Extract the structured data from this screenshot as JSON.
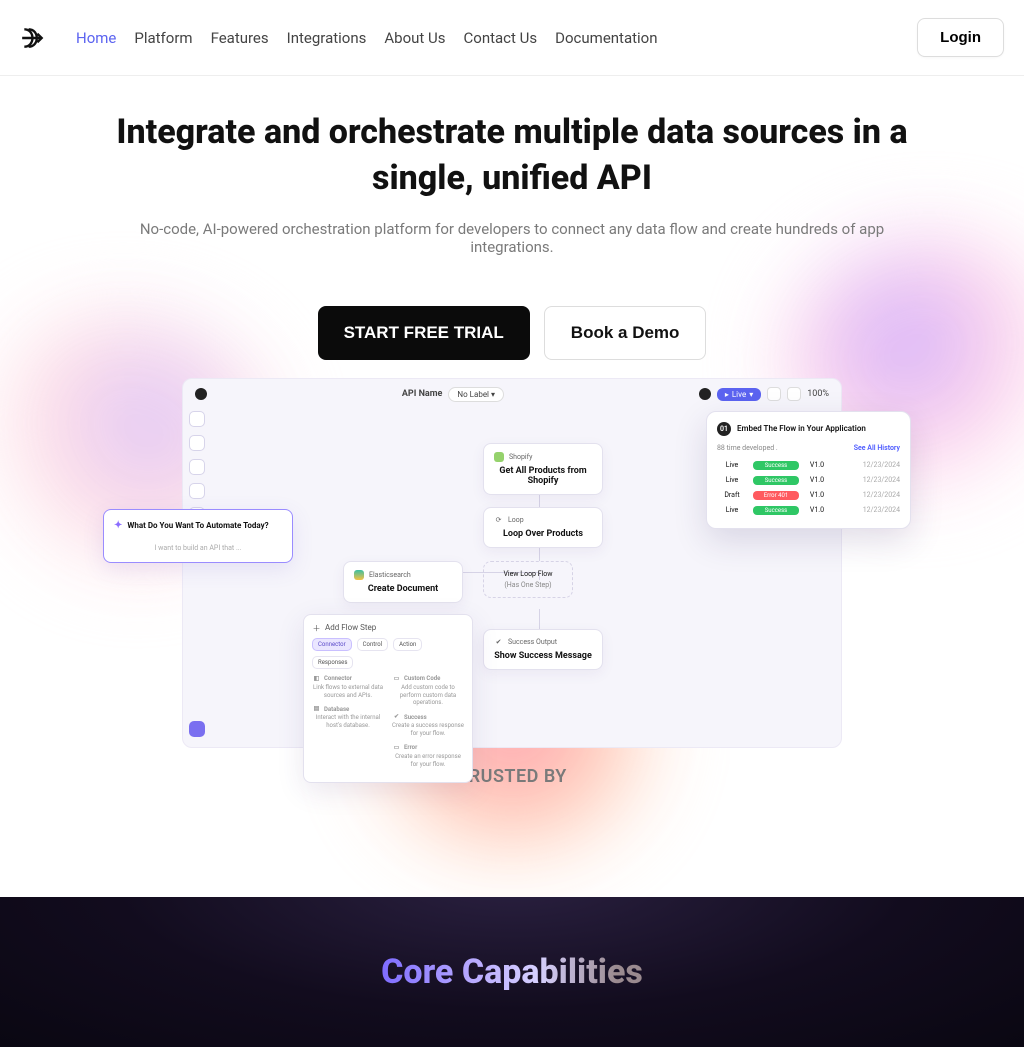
{
  "nav": {
    "links": [
      "Home",
      "Platform",
      "Features",
      "Integrations",
      "About Us",
      "Contact Us",
      "Documentation"
    ],
    "active_index": 0,
    "login": "Login"
  },
  "hero": {
    "title": "Integrate and orchestrate multiple data sources in a single, unified API",
    "subtitle": "No-code, AI-powered orchestration platform for developers to connect any data flow and create hundreds of app integrations.",
    "cta_primary": "START FREE TRIAL",
    "cta_secondary": "Book a Demo"
  },
  "mock": {
    "api_name_label": "API Name",
    "tag_chip": "No Label ▾",
    "live_label": "Live",
    "zoom": "100%",
    "ai_prompt_title": "What Do You Want To Automate Today?",
    "ai_prompt_placeholder": "I want to build an API that ...",
    "nodes": {
      "shopify": {
        "brand": "Shopify",
        "title": "Get All Products from Shopify"
      },
      "loop": {
        "brand": "Loop",
        "title": "Loop Over Products"
      },
      "elastic": {
        "brand": "Elasticsearch",
        "title": "Create Document"
      },
      "view_loop": {
        "a": "View Loop Flow",
        "b": "(Has One Step)"
      },
      "success": {
        "brand": "Success Output",
        "title": "Show Success Message"
      }
    },
    "palette": {
      "title": "Add Flow Step",
      "tabs": [
        "Connector",
        "Control",
        "Action",
        "Responses"
      ],
      "items": [
        {
          "name": "Connector",
          "desc": "Link flows to external data sources and APIs."
        },
        {
          "name": "Database",
          "desc": "Interact with the internal host's database."
        },
        {
          "name": "Custom Code",
          "desc": "Add custom code to perform custom data operations."
        },
        {
          "name": "Success",
          "desc": "Create a success response for your flow."
        },
        {
          "name": "Error",
          "desc": "Create an error response for your flow."
        }
      ]
    },
    "history": {
      "title": "Embed The Flow in Your Application",
      "step_number": "01",
      "subtitle": "88 time developed .",
      "link": "See All History",
      "rows": [
        {
          "state": "Live",
          "status": "Success",
          "ok": true,
          "ver": "V1.0",
          "date": "12/23/2024"
        },
        {
          "state": "Live",
          "status": "Success",
          "ok": true,
          "ver": "V1.0",
          "date": "12/23/2024"
        },
        {
          "state": "Draft",
          "status": "Error 401",
          "ok": false,
          "ver": "V1.0",
          "date": "12/23/2024"
        },
        {
          "state": "Live",
          "status": "Success",
          "ok": true,
          "ver": "V1.0",
          "date": "12/23/2024"
        }
      ]
    }
  },
  "trusted_by": "TRUSTED BY",
  "core_capabilities": "Core Capabilities"
}
